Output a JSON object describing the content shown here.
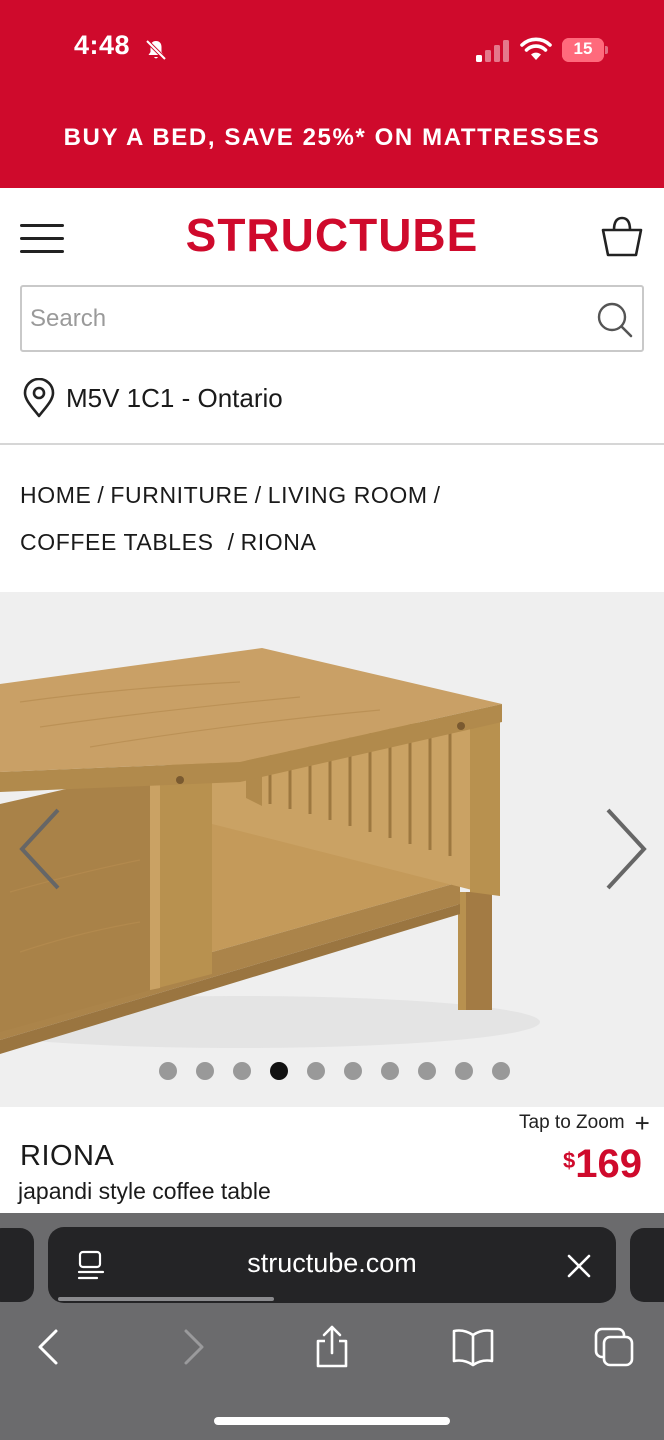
{
  "status_bar": {
    "time": "4:48",
    "battery": "15",
    "icons": [
      "bell-slash-icon",
      "cellular-signal-icon",
      "wifi-icon",
      "battery-icon"
    ]
  },
  "promo": {
    "text": "BUY A BED, SAVE 25%* ON MATTRESSES"
  },
  "header": {
    "logo": "STRUCTUBE",
    "brand_color": "#cf0a2c"
  },
  "search": {
    "placeholder": "Search",
    "value": ""
  },
  "location": {
    "text": "M5V 1C1 - Ontario"
  },
  "breadcrumb": [
    {
      "label": "HOME"
    },
    {
      "label": "FURNITURE"
    },
    {
      "label": "LIVING ROOM"
    },
    {
      "label": "COFFEE TABLES"
    },
    {
      "label": "RIONA"
    }
  ],
  "gallery": {
    "image_count": 10,
    "active_index": 3
  },
  "product": {
    "zoom_label": "Tap to Zoom",
    "zoom_icon": "+",
    "name": "RIONA",
    "subtitle": "japandi style coffee table",
    "price_currency": "$",
    "price": "169"
  },
  "browser": {
    "url": "structube.com",
    "load_progress": 0.38,
    "toolbar": [
      "back-icon",
      "forward-icon",
      "share-icon",
      "bookmarks-icon",
      "tabs-icon"
    ]
  }
}
